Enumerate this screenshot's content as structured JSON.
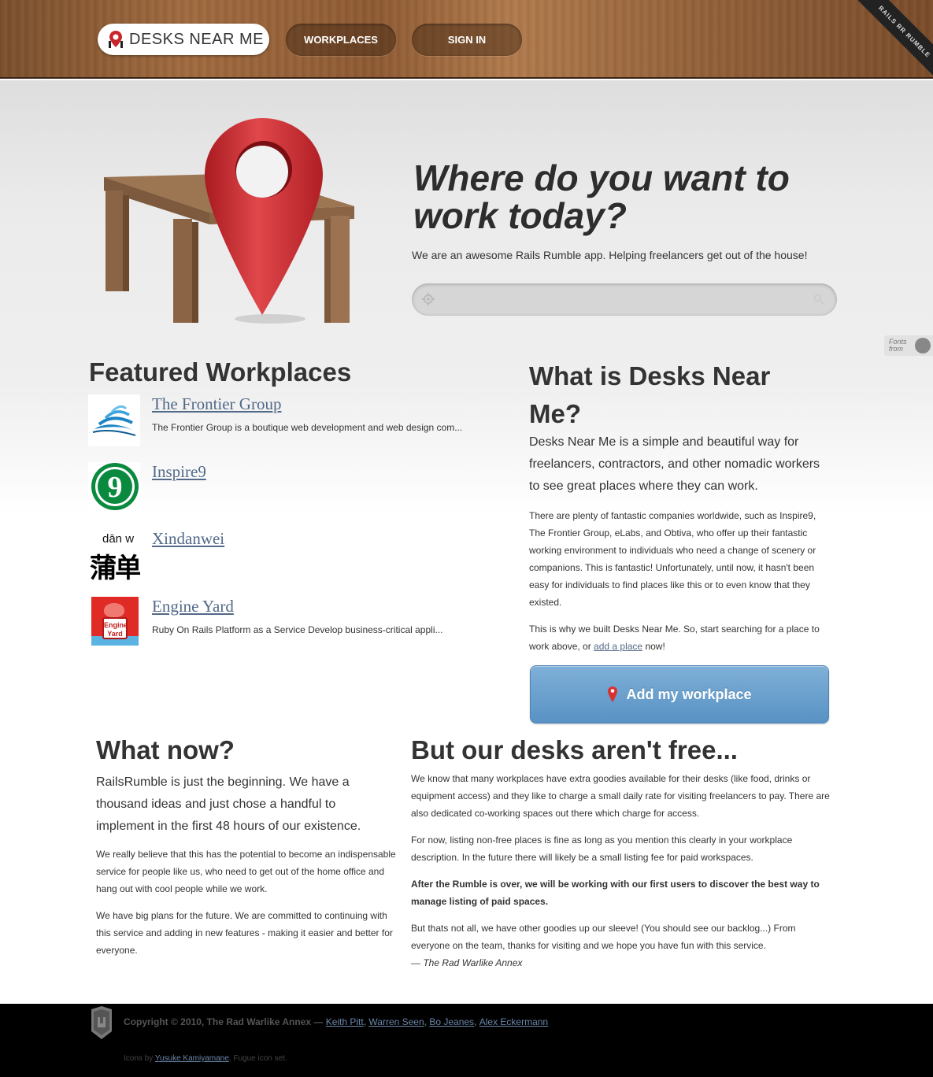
{
  "header": {
    "logo_text": "DESKS NEAR ME",
    "nav": {
      "workplaces": "WORKPLACES",
      "sign_in": "SIGN IN"
    },
    "ribbon": "RAILS RR RUMBLE"
  },
  "hero": {
    "title": "Where do you want to work today?",
    "subtitle": "We are an awesome Rails Rumble app. Helping freelancers get out of the house!",
    "search_value": ""
  },
  "fonts_from": {
    "line1": "Fonts",
    "line2": "from"
  },
  "featured": {
    "title": "Featured Workplaces",
    "items": [
      {
        "name": "The Frontier Group",
        "desc": "The Frontier Group is a boutique web development and web design com..."
      },
      {
        "name": "Inspire9",
        "desc": ""
      },
      {
        "name": "Xindanwei",
        "desc": ""
      },
      {
        "name": "Engine Yard",
        "desc": "Ruby On Rails Platform as a Service Develop business-critical appli..."
      }
    ],
    "inspire9_logo": "9",
    "xindanwei_logo": {
      "pinyin": "dān w",
      "chars": "蒲单"
    },
    "engineyard_logo": {
      "line1": "Engine",
      "line2": "Yard"
    }
  },
  "about": {
    "title": "What is Desks Near Me?",
    "lead": "Desks Near Me is a simple and beautiful way for freelancers, contractors, and other nomadic workers to see great places where they can work.",
    "p1": "There are plenty of fantastic companies worldwide, such as Inspire9, The Frontier Group, eLabs, and Obtiva, who offer up their fantastic working environment to individuals who need a change of scenery or companions. This is fantastic! Unfortunately, until now, it hasn't been easy for individuals to find places like this or to even know that they existed.",
    "p2_before": "This is why we built Desks Near Me. So, start searching for a place to work above, or ",
    "p2_link": "add a place",
    "p2_after": " now!",
    "add_button": "Add my workplace"
  },
  "what_now": {
    "title": "What now?",
    "lead": "RailsRumble is just the beginning. We have a thousand ideas and just chose a handful to implement in the first 48 hours of our existence.",
    "p1": "We really believe that this has the potential to become an indispensable service for people like us, who need to get out of the home office and hang out with cool people while we work.",
    "p2": "We have big plans for the future. We are committed to continuing with this service and adding in new features - making it easier and better for everyone."
  },
  "not_free": {
    "title": "But our desks aren't free...",
    "p1": "We know that many workplaces have extra goodies available for their desks (like food, drinks or equipment access) and they like to charge a small daily rate for visiting freelancers to pay. There are also dedicated co-working spaces out there which charge for access.",
    "p2": "For now, listing non-free places is fine as long as you mention this clearly in your workplace description. In the future there will likely be a small listing fee for paid workspaces.",
    "p3": "After the Rumble is over, we will be working with our first users to discover the best way to manage listing of paid spaces.",
    "p4": "But thats not all, we have other goodies up our sleeve! (You should see our backlog...) From everyone on the team, thanks for visiting and we hope you have fun with this service.",
    "signature": "— The Rad Warlike Annex"
  },
  "footer": {
    "copyright": "Copyright © 2010, The Rad Warlike Annex — ",
    "authors": [
      "Keith Pitt",
      "Warren Seen",
      "Bo Jeanes",
      "Alex Eckermann"
    ],
    "icons_prefix": "Icons by ",
    "icons_author": "Yusuke Kamiyamane",
    "icons_suffix": ", Fugue icon set."
  },
  "colors": {
    "link": "#526987",
    "button_blue": "#5892c4",
    "pin_red": "#c8262c",
    "wood": "#8e5a33"
  }
}
